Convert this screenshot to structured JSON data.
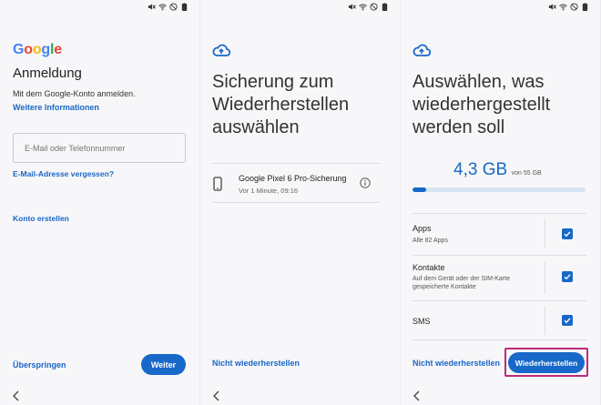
{
  "screen1": {
    "logo": "Google",
    "title": "Anmeldung",
    "subtitle": "Mit dem Google-Konto anmelden.",
    "more_info": "Weitere Informationen",
    "email_placeholder": "E-Mail oder Telefonnummer",
    "forgot_email": "E-Mail-Adresse vergessen?",
    "create_account": "Konto erstellen",
    "skip": "Überspringen",
    "next": "Weiter"
  },
  "screen2": {
    "title": "Sicherung zum Wiederherstellen auswählen",
    "backup_name": "Google Pixel 6 Pro-Sicherung",
    "backup_time": "Vor 1 Minute, 09:16",
    "dont_restore": "Nicht wiederherstellen"
  },
  "screen3": {
    "title": "Auswählen, was wiederhergestellt werden soll",
    "size_value": "4,3 GB",
    "size_total": "von 55 GB",
    "progress_fraction": 0.078,
    "options": [
      {
        "label": "Apps",
        "sub": "Alle 82 Apps",
        "checked": true
      },
      {
        "label": "Kontakte",
        "sub": "Auf dem Gerät oder der SIM-Karte gespeicherte Kontakte",
        "checked": true
      },
      {
        "label": "SMS",
        "sub": "",
        "checked": true
      }
    ],
    "dont_restore": "Nicht wiederherstellen",
    "restore": "Wiederherstellen"
  },
  "colors": {
    "accent": "#1768c9",
    "link": "#1a66c9",
    "highlight": "#c0287a",
    "google_blue": "#4285f4",
    "google_red": "#ea4335",
    "google_yellow": "#fbbc05",
    "google_green": "#34a853"
  },
  "icons": [
    "mute-icon",
    "wifi-icon",
    "do-not-disturb-icon",
    "battery-icon",
    "cloud-upload-icon",
    "phone-icon",
    "info-icon",
    "checkbox-checked-icon",
    "back-icon"
  ]
}
